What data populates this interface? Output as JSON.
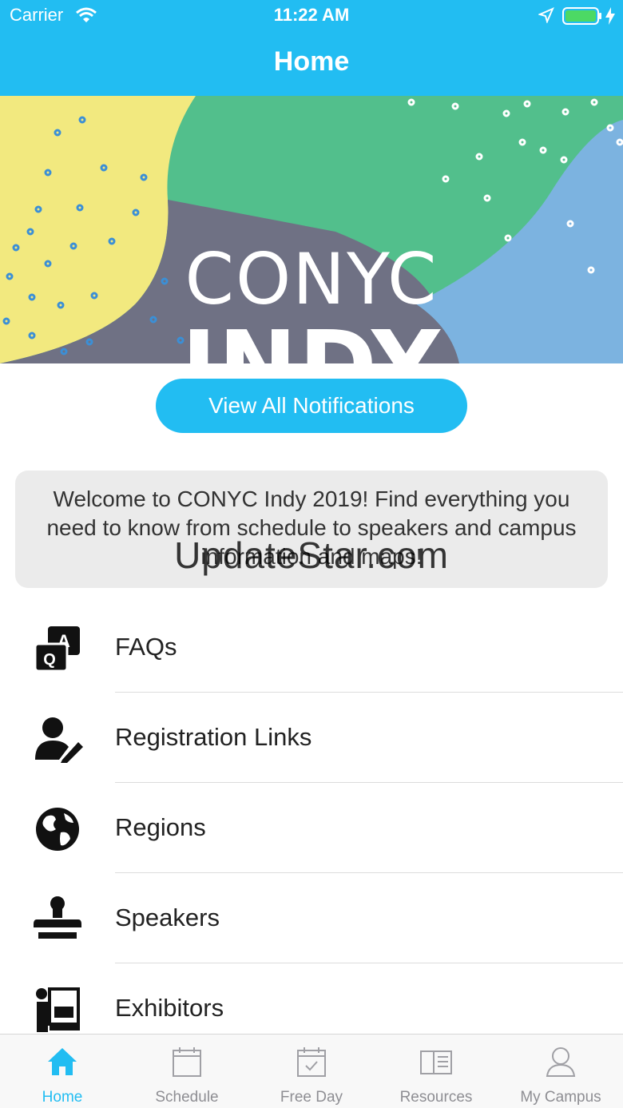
{
  "status_bar": {
    "carrier": "Carrier",
    "time": "11:22 AM"
  },
  "nav": {
    "title": "Home"
  },
  "banner": {
    "line1": "CONYC",
    "line2": "INDY"
  },
  "notifications_button": {
    "label": "View All Notifications"
  },
  "welcome": {
    "text": "Welcome to CONYC Indy 2019! Find everything you need to know from schedule to speakers and campus information and maps!"
  },
  "watermark": "UpdateStar.com",
  "menu": {
    "items": [
      {
        "label": "FAQs",
        "icon": "faq-icon"
      },
      {
        "label": "Registration Links",
        "icon": "user-edit-icon"
      },
      {
        "label": "Regions",
        "icon": "globe-icon"
      },
      {
        "label": "Speakers",
        "icon": "stamp-icon"
      },
      {
        "label": "Exhibitors",
        "icon": "presenter-icon"
      }
    ]
  },
  "tabs": [
    {
      "label": "Home",
      "icon": "home-icon",
      "active": true
    },
    {
      "label": "Schedule",
      "icon": "calendar-icon",
      "active": false
    },
    {
      "label": "Free Day",
      "icon": "calendar-check-icon",
      "active": false
    },
    {
      "label": "Resources",
      "icon": "book-icon",
      "active": false
    },
    {
      "label": "My Campus",
      "icon": "person-icon",
      "active": false
    }
  ],
  "colors": {
    "accent": "#22bdf2",
    "banner_yellow": "#f2e97f",
    "banner_green": "#52bf8c",
    "banner_slate": "#6f7184",
    "banner_blue": "#7cb3e0"
  }
}
